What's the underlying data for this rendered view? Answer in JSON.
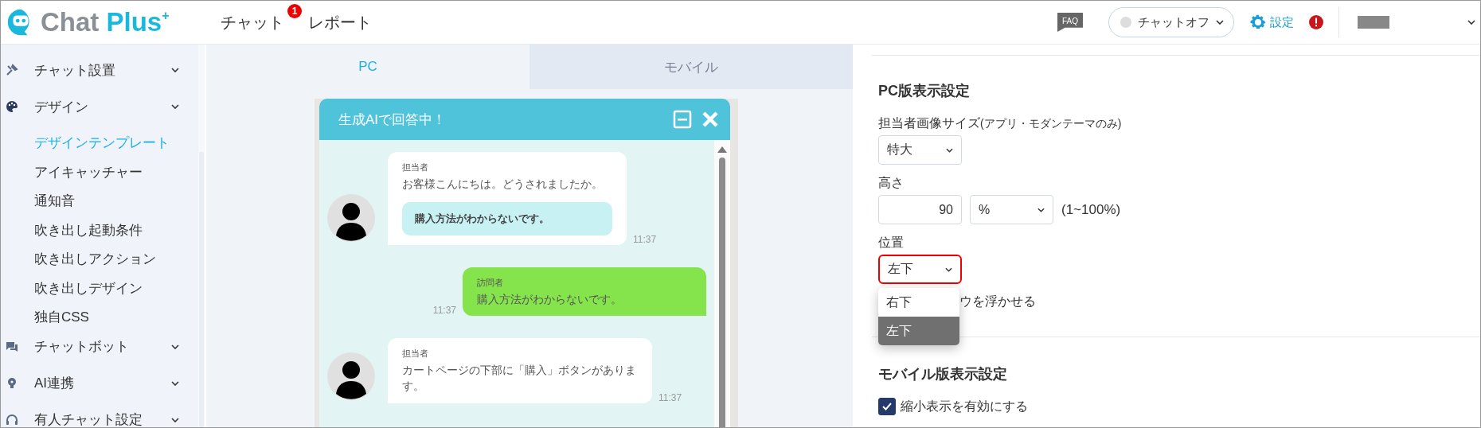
{
  "header": {
    "logo": {
      "name": "Chat",
      "accent": "Plus",
      "mark": "+"
    },
    "nav": [
      {
        "label": "チャット",
        "badge": "1"
      },
      {
        "label": "レポート"
      }
    ],
    "faq": "FAQ",
    "status": {
      "label": "チャットオフ",
      "on": false
    },
    "settings": "設定"
  },
  "sidebar": {
    "groups": [
      {
        "kind": "tools",
        "label": "チャット設置"
      },
      {
        "kind": "palette",
        "label": "デザイン",
        "expanded": true,
        "children": [
          {
            "label": "デザインテンプレート",
            "selected": true
          },
          {
            "label": "アイキャッチャー",
            "selected": false
          },
          {
            "label": "通知音",
            "selected": false
          },
          {
            "label": "吹き出し起動条件",
            "selected": false
          },
          {
            "label": "吹き出しアクション",
            "selected": false
          },
          {
            "label": "吹き出しデザイン",
            "selected": false
          },
          {
            "label": "独自CSS",
            "selected": false
          }
        ]
      },
      {
        "kind": "chat",
        "label": "チャットボット"
      },
      {
        "kind": "bulb",
        "label": "AI連携"
      },
      {
        "kind": "headset",
        "label": "有人チャット設定"
      }
    ]
  },
  "preview": {
    "tabs": [
      {
        "label": "PC",
        "selected": true
      },
      {
        "label": "モバイル",
        "selected": false
      }
    ],
    "chat": {
      "title": "生成AIで回答中！",
      "messages": [
        {
          "kind": "agent",
          "sender": "担当者",
          "text": "お客様こんにちは。どうされましたか。",
          "quick_reply": "購入方法がわからないです。",
          "time": "11:37"
        },
        {
          "kind": "visitor",
          "sender": "訪問者",
          "text": "購入方法がわからないです。",
          "time": "11:37"
        },
        {
          "kind": "agent",
          "sender": "担当者",
          "text": "カートページの下部に「購入」ボタンがあります。",
          "time": "11:37"
        }
      ]
    }
  },
  "settings": {
    "pc": {
      "title": "PC版表示設定",
      "avatar_size": {
        "label": "担当者画像サイズ",
        "note": "(アプリ・モダンテーマのみ)",
        "value": "特大"
      },
      "height": {
        "label": "高さ",
        "value": "90",
        "unit": "%",
        "range": "(1~100%)"
      },
      "position": {
        "label": "位置",
        "value": "左下",
        "highlighted": true,
        "open": true,
        "options": [
          {
            "label": "右下",
            "selected": false
          },
          {
            "label": "左下",
            "selected": true
          }
        ]
      },
      "float_option": "ウを浮かせる"
    },
    "mobile": {
      "title": "モバイル版表示設定",
      "shrink": {
        "label": "縮小表示を有効にする",
        "checked": true
      }
    }
  }
}
